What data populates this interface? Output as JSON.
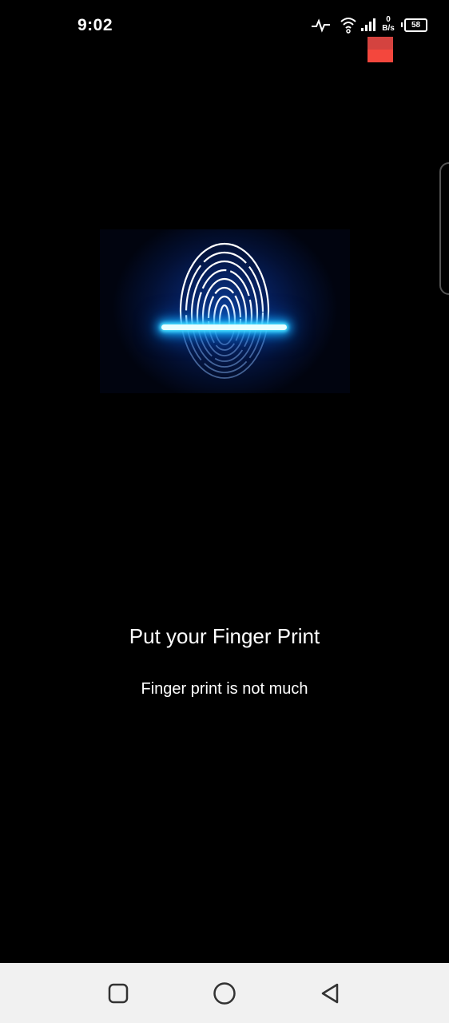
{
  "status_bar": {
    "time": "9:02",
    "net_speed_value": "0",
    "net_speed_unit": "B/s",
    "battery_level": "58",
    "icons": [
      "activity-icon",
      "wifi-icon",
      "signal-icon",
      "battery-icon"
    ]
  },
  "scanner": {
    "image": "fingerprint-scan-illustration",
    "glow_color": "#18b6ff"
  },
  "prompt": {
    "title": "Put your Finger Print",
    "subtitle": "Finger print is not much"
  },
  "nav_bar": {
    "buttons": [
      "recents-button",
      "home-button",
      "back-button"
    ]
  },
  "colors": {
    "background": "#000000",
    "nav_background": "#f1f1f1",
    "indicator": "#f4473d"
  }
}
